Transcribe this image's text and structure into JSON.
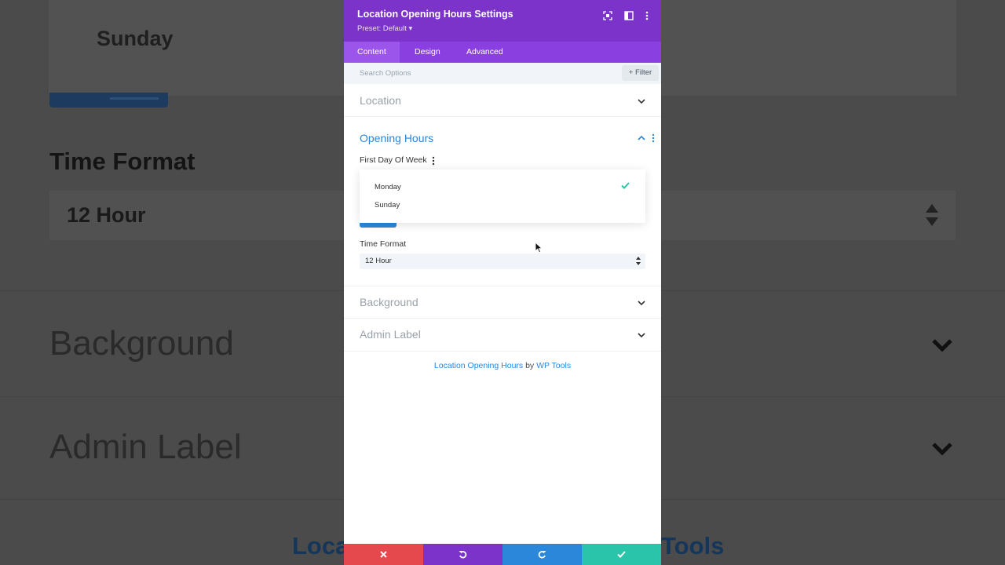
{
  "background_page": {
    "selected_day": "Sunday",
    "time_format_heading": "Time Format",
    "time_format_value": "12 Hour",
    "section_background": "Background",
    "section_admin_label": "Admin Label",
    "footer_left": "Loca",
    "footer_right": "Tools"
  },
  "modal": {
    "title": "Location Opening Hours Settings",
    "preset": "Preset: Default ▾",
    "header_icons": [
      "focus-icon",
      "split-view-icon",
      "more-vertical-icon"
    ],
    "tabs": [
      {
        "label": "Content",
        "active": true
      },
      {
        "label": "Design",
        "active": false
      },
      {
        "label": "Advanced",
        "active": false
      }
    ],
    "search": {
      "placeholder": "Search Options",
      "filter_label": "Filter"
    },
    "sections": {
      "location": "Location",
      "opening_hours": "Opening Hours",
      "background": "Background",
      "admin_label": "Admin Label"
    },
    "first_day_field": {
      "label": "First Day Of Week",
      "options": [
        "Monday",
        "Sunday"
      ],
      "selected": "Monday"
    },
    "time_format_field": {
      "label": "Time Format",
      "value": "12 Hour"
    },
    "credit": {
      "module_link": "Location Opening Hours",
      "by": " by ",
      "author_link": "WP Tools"
    },
    "bottom_bar": [
      {
        "name": "discard",
        "icon": "close-icon",
        "color": "#e5484d"
      },
      {
        "name": "undo",
        "icon": "undo-icon",
        "color": "#7b33c9"
      },
      {
        "name": "redo",
        "icon": "redo-icon",
        "color": "#2b87da"
      },
      {
        "name": "save",
        "icon": "check-icon",
        "color": "#29c4a9"
      }
    ]
  },
  "colors": {
    "header_purple": "#7b33c9",
    "tab_purple": "#8a3fe0",
    "accent_blue": "#2b87da",
    "check_green": "#29c4a9"
  }
}
